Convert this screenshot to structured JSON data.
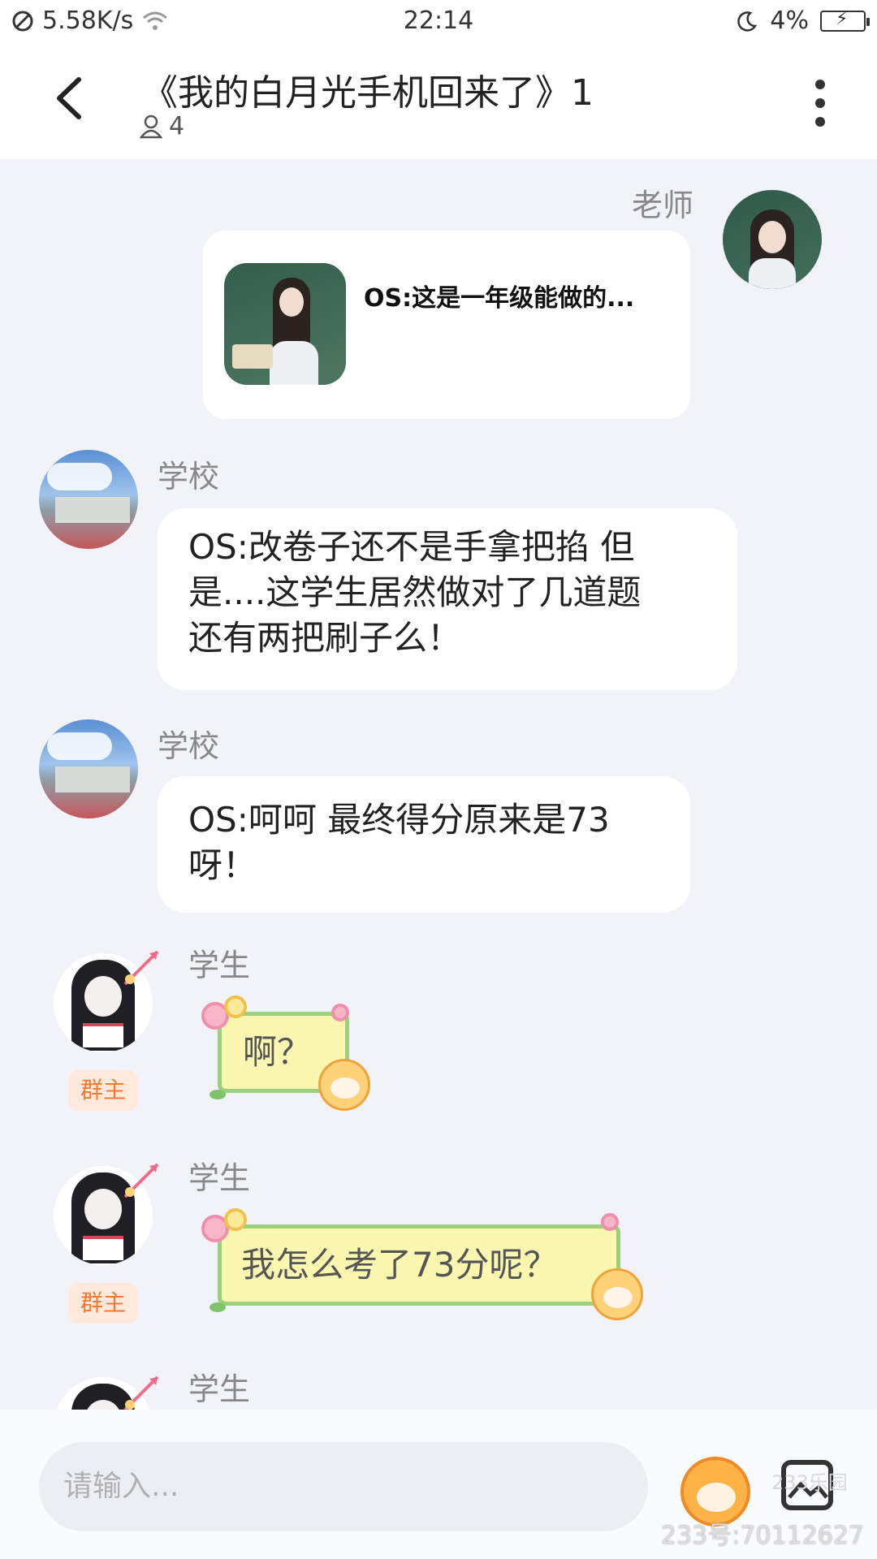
{
  "status_bar": {
    "speed": "5.58K/s",
    "time": "22:14",
    "battery": "4%"
  },
  "header": {
    "title": "《我的白月光手机回来了》1",
    "member_count": "4"
  },
  "messages": [
    {
      "sender": "老师",
      "side": "right",
      "type": "card",
      "text": "OS:这是一年级能做的..."
    },
    {
      "sender": "学校",
      "side": "left",
      "type": "text",
      "lines": [
        "OS:改卷子还不是手拿把掐 但",
        "是....这学生居然做对了几道题",
        "还有两把刷子么！"
      ]
    },
    {
      "sender": "学校",
      "side": "left",
      "type": "text",
      "lines": [
        "OS:呵呵 最终得分原来是73",
        "呀！"
      ]
    },
    {
      "sender": "学生",
      "side": "left",
      "type": "sticker-text",
      "badge": "群主",
      "text": "啊？"
    },
    {
      "sender": "学生",
      "side": "left",
      "type": "sticker-text",
      "badge": "群主",
      "text": "我怎么考了73分呢？"
    },
    {
      "sender": "学生",
      "side": "left",
      "type": "partial"
    }
  ],
  "input": {
    "placeholder": "请输入..."
  },
  "watermark": {
    "logo": "233乐园",
    "id": "233号:70112627"
  },
  "colors": {
    "badge_bg": "#ffe9dc",
    "badge_text": "#f07a34",
    "sticker_bg": "#fbf6b0",
    "sticker_border": "#9bd17c"
  }
}
